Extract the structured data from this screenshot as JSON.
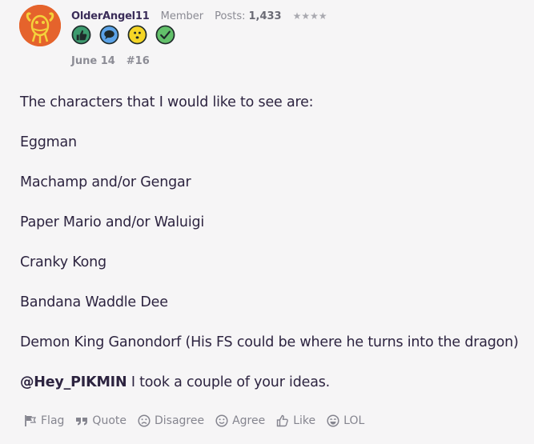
{
  "post": {
    "author": {
      "username": "OlderAngel11",
      "role": "Member",
      "posts_label": "Posts:",
      "posts_count": "1,433",
      "stars": "★★★★"
    },
    "badges": [
      {
        "icon": "thumbs-up-badge-icon",
        "color": "#3d9b6e"
      },
      {
        "icon": "speech-bubble-badge-icon",
        "color": "#4a8fd8"
      },
      {
        "icon": "smiley-badge-icon",
        "color": "#f2cf1e"
      },
      {
        "icon": "checkmark-badge-icon",
        "color": "#5cb85c"
      }
    ],
    "date": "June 14",
    "post_number": "#16",
    "paragraphs": [
      "The characters that I would like to see are:",
      "Eggman",
      "Machamp and/or Gengar",
      "Paper Mario and/or Waluigi",
      "Cranky Kong",
      "Bandana Waddle Dee",
      "Demon King Ganondorf (His FS could be where he turns into the dragon)"
    ],
    "last_line": {
      "mention": "@Hey_PIKMIN",
      "text": " I took a couple of your ideas."
    }
  },
  "actions": {
    "flag": "Flag",
    "quote": "Quote",
    "disagree": "Disagree",
    "agree": "Agree",
    "like": "Like",
    "lol": "LOL"
  },
  "colors": {
    "background": "#f6f5f6",
    "text": "#2d2440",
    "muted": "#85858f",
    "avatar": "#e5632c"
  }
}
